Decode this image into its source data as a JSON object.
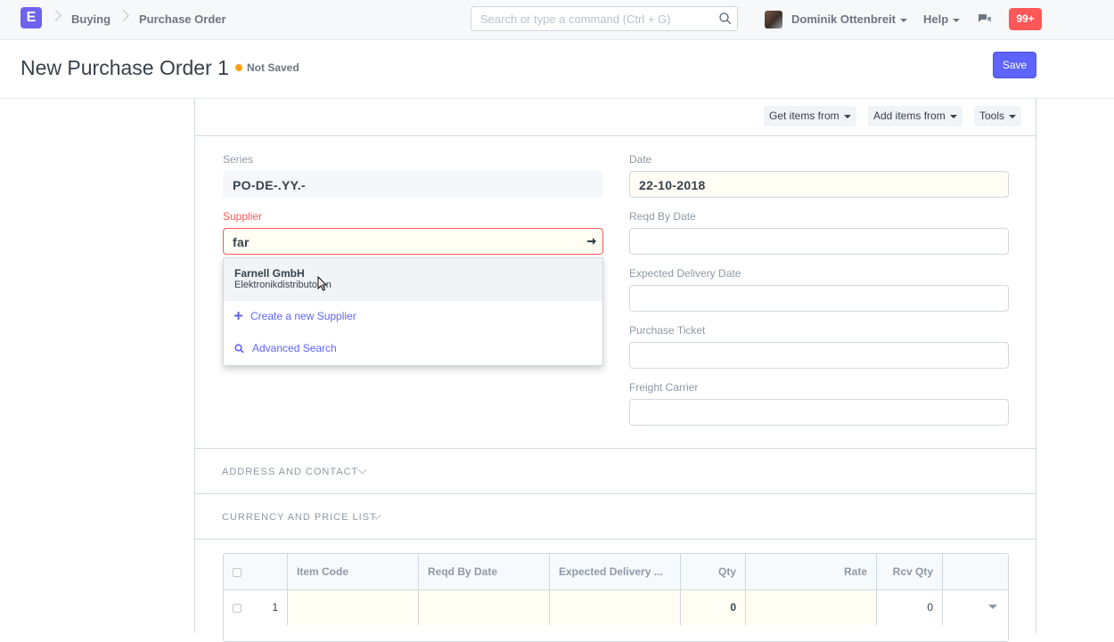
{
  "navbar": {
    "logo": "E",
    "breadcrumbs": [
      "Buying",
      "Purchase Order"
    ],
    "search_placeholder": "Search or type a command (Ctrl + G)",
    "user": "Dominik Ottenbreit",
    "help": "Help",
    "notifications": "99+"
  },
  "page": {
    "title": "New Purchase Order 1",
    "status": "Not Saved",
    "save": "Save"
  },
  "toolbar": {
    "get_items": "Get items from",
    "add_items": "Add items from",
    "tools": "Tools"
  },
  "fields": {
    "series_label": "Series",
    "series_value": "PO-DE-.YY.-",
    "supplier_label": "Supplier",
    "supplier_value": "far",
    "date_label": "Date",
    "date_value": "22-10-2018",
    "reqd_label": "Reqd By Date",
    "expected_label": "Expected Delivery Date",
    "ticket_label": "Purchase Ticket",
    "carrier_label": "Freight Carrier"
  },
  "dropdown": {
    "item_name": "Farnell GmbH",
    "item_desc": "Elektronikdistributoren",
    "create": "Create a new Supplier",
    "advanced": "Advanced Search"
  },
  "sections": {
    "address": "ADDRESS AND CONTACT",
    "currency": "CURRENCY AND PRICE LIST"
  },
  "grid": {
    "headers": [
      "Item Code",
      "Reqd By Date",
      "Expected Delivery ...",
      "Qty",
      "Rate",
      "Rcv Qty"
    ],
    "row": {
      "idx": "1",
      "qty": "0",
      "rcv": "0"
    }
  },
  "colors": {
    "accent": "#5e64ff",
    "danger": "#ff5858",
    "warning": "#ffa00a"
  }
}
